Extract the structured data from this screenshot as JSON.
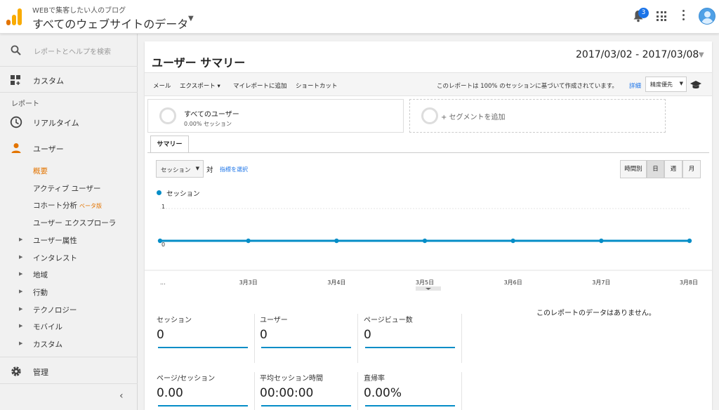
{
  "header": {
    "account_name": "WEBで集客したい人のブログ",
    "view_name": "すべてのウェブサイトのデータ",
    "notification_count": "3"
  },
  "sidebar": {
    "search_placeholder": "レポートとヘルプを検索",
    "custom": "カスタム",
    "reports_section": "レポート",
    "realtime": "リアルタイム",
    "users": "ユーザー",
    "sub_items": {
      "overview": "概要",
      "active_users": "アクティブ ユーザー",
      "cohort": "コホート分析",
      "cohort_badge": "ベータ版",
      "user_explorer": "ユーザー エクスプローラ"
    },
    "expandables": [
      "ユーザー属性",
      "インタレスト",
      "地域",
      "行動",
      "テクノロジー",
      "モバイル",
      "カスタム"
    ],
    "admin": "管理",
    "collapse_icon": "chevron-left-icon"
  },
  "main": {
    "title": "ユーザー サマリー",
    "date_range": "2017/03/02 - 2017/03/08",
    "toolbar": {
      "mail": "メール",
      "export": "エクスポート ▾",
      "add_to_dashboard": "マイレポートに追加",
      "shortcut": "ショートカット",
      "sampling_note": "このレポートは 100% のセッションに基づいて作成されています。",
      "details_link": "詳細",
      "precision": "精度優先"
    },
    "segments": {
      "all_users": "すべてのユーザー",
      "all_users_sub": "0.00% セッション",
      "add_segment": "+ セグメントを追加"
    },
    "tab_summary": "サマリー",
    "metric_select": "セッション",
    "vs": "対",
    "select_metric": "指標を選択",
    "granularity": [
      "時間別",
      "日",
      "週",
      "月"
    ],
    "granularity_selected": "日",
    "no_data": "このレポートのデータはありません。",
    "kpis": [
      {
        "label": "セッション",
        "value": "0"
      },
      {
        "label": "ユーザー",
        "value": "0"
      },
      {
        "label": "ページビュー数",
        "value": "0"
      },
      {
        "label": "ページ/セッション",
        "value": "0.00"
      },
      {
        "label": "平均セッション時間",
        "value": "00:00:00"
      },
      {
        "label": "直帰率",
        "value": "0.00%"
      }
    ]
  },
  "chart_data": {
    "type": "line",
    "series": [
      {
        "name": "セッション",
        "values": [
          0,
          0,
          0,
          0,
          0,
          0,
          0
        ]
      }
    ],
    "x": [
      "...",
      "3月3日",
      "3月4日",
      "3月5日",
      "3月6日",
      "3月7日",
      "3月8日"
    ],
    "y_ticks": [
      "1",
      "0"
    ],
    "ylim": [
      0,
      1
    ],
    "grid": true,
    "color": "#058dc7"
  }
}
